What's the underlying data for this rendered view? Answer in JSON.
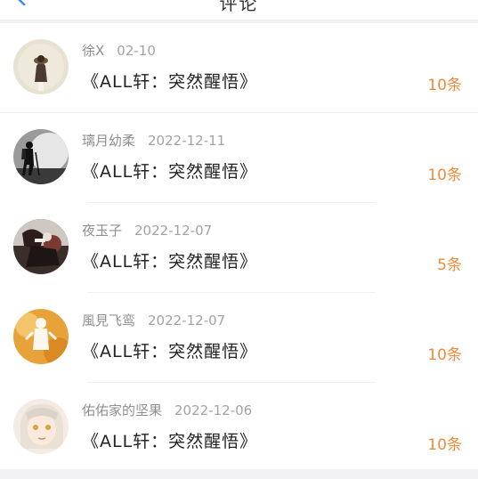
{
  "header": {
    "title": "评论"
  },
  "colors": {
    "accent": "#ef8b3a",
    "back_icon": "#3a8bf0"
  },
  "comments": [
    {
      "user": "徐X",
      "date": "02-10",
      "text": "《ALL轩：突然醒悟》",
      "count": "10条",
      "avatar_icon": "avatar-figure-hat-icon"
    },
    {
      "user": "璃月幼柔",
      "date": "2022-12-11",
      "text": "《ALL轩：突然醒悟》",
      "count": "10条",
      "avatar_icon": "avatar-hiker-silhouette-icon"
    },
    {
      "user": "夜玉子",
      "date": "2022-12-07",
      "text": "《ALL轩：突然醒悟》",
      "count": "5条",
      "avatar_icon": "avatar-dark-character-icon"
    },
    {
      "user": "風見飞鸾",
      "date": "2022-12-07",
      "text": "《ALL轩：突然醒悟》",
      "count": "10条",
      "avatar_icon": "avatar-autumn-figure-icon"
    },
    {
      "user": "佑佑家的坚果",
      "date": "2022-12-06",
      "text": "《ALL轩：突然醒悟》",
      "count": "10条",
      "avatar_icon": "avatar-anime-girl-icon"
    }
  ]
}
